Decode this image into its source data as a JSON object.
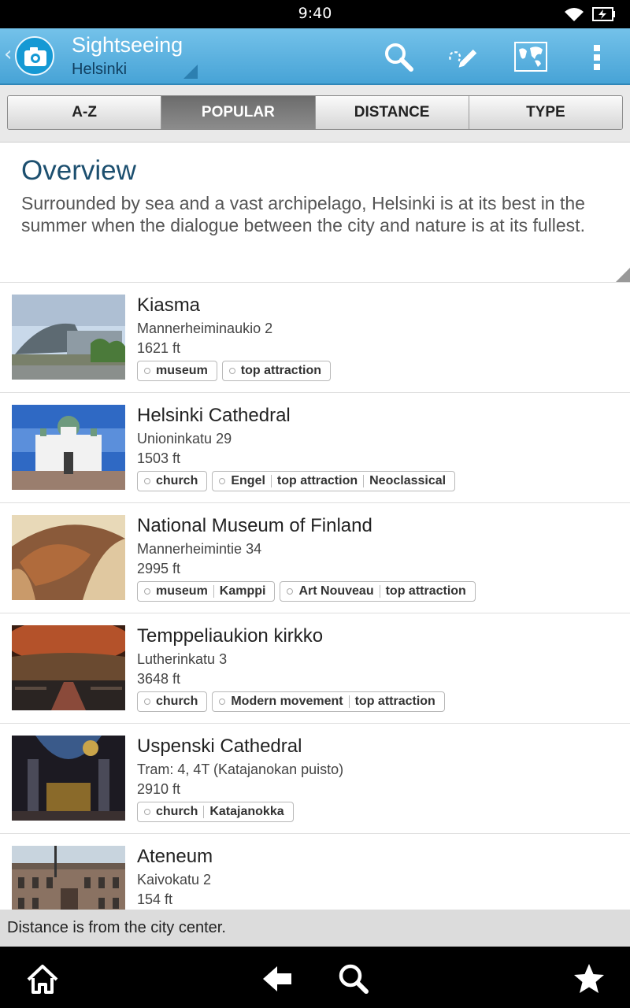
{
  "status_bar": {
    "time": "9:40"
  },
  "header": {
    "title": "Sightseeing",
    "subtitle": "Helsinki"
  },
  "tabs": [
    {
      "label": "A-Z",
      "active": false
    },
    {
      "label": "POPULAR",
      "active": true
    },
    {
      "label": "DISTANCE",
      "active": false
    },
    {
      "label": "TYPE",
      "active": false
    }
  ],
  "overview": {
    "heading": "Overview",
    "text": "Surrounded by sea and a vast archipelago, Helsinki is at its best in the summer when the dialogue between the city and nature is at its fullest."
  },
  "places": [
    {
      "name": "Kiasma",
      "address": "Mannerheiminaukio 2",
      "distance": "1621 ft",
      "tag_groups": [
        [
          "museum"
        ],
        [
          "top attraction"
        ]
      ]
    },
    {
      "name": "Helsinki Cathedral",
      "address": "Unioninkatu 29",
      "distance": "1503 ft",
      "tag_groups": [
        [
          "church"
        ],
        [
          "Engel",
          "top attraction",
          "Neoclassical"
        ]
      ]
    },
    {
      "name": "National Museum of Finland",
      "address": "Mannerheimintie 34",
      "distance": "2995 ft",
      "tag_groups": [
        [
          "museum",
          "Kamppi"
        ],
        [
          "Art Nouveau",
          "top attraction"
        ]
      ]
    },
    {
      "name": "Temppeliaukion kirkko",
      "address": "Lutherinkatu 3",
      "distance": "3648 ft",
      "tag_groups": [
        [
          "church"
        ],
        [
          "Modern movement",
          "top attraction"
        ]
      ]
    },
    {
      "name": "Uspenski Cathedral",
      "address": "Tram: 4, 4T (Katajanokan puisto)",
      "distance": "2910 ft",
      "tag_groups": [
        [
          "church",
          "Katajanokka"
        ]
      ]
    },
    {
      "name": "Ateneum",
      "address": "Kaivokatu 2",
      "distance": "154 ft",
      "tag_groups": []
    }
  ],
  "footer_note": "Distance is from the city center.",
  "icons": {
    "app": "camera-icon",
    "search": "search-icon",
    "edit": "edit-route-icon",
    "map": "map-icon",
    "overflow": "overflow-menu-icon",
    "home": "home-icon",
    "back": "back-arrow-icon",
    "nav_search": "search-icon",
    "favorites": "star-icon"
  },
  "colors": {
    "actionbar": "#47a3d6",
    "overview_heading": "#1c4f6f"
  }
}
